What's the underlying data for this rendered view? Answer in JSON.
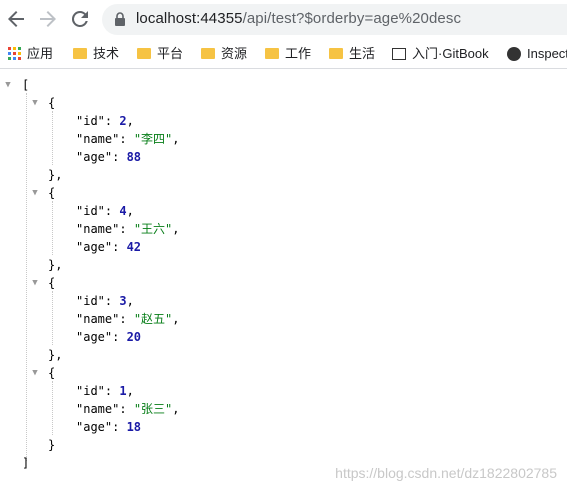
{
  "browser": {
    "url_host": "localhost:44355",
    "url_path": "/api/test?$orderby=age%20desc"
  },
  "bookmarks": [
    {
      "label": "应用",
      "icon": "apps-grid-icon"
    },
    {
      "label": "技术",
      "icon": "folder-icon"
    },
    {
      "label": "平台",
      "icon": "folder-icon"
    },
    {
      "label": "资源",
      "icon": "folder-icon"
    },
    {
      "label": "工作",
      "icon": "folder-icon"
    },
    {
      "label": "生活",
      "icon": "folder-icon"
    },
    {
      "label": "入门·GitBook",
      "icon": "book-icon"
    },
    {
      "label": "Inspect",
      "icon": "globe-icon"
    }
  ],
  "json": {
    "open_bracket": "[",
    "close_bracket": "]",
    "items": [
      {
        "id": "2",
        "name": "\"李四\"",
        "age": "88"
      },
      {
        "id": "4",
        "name": "\"王六\"",
        "age": "42"
      },
      {
        "id": "3",
        "name": "\"赵五\"",
        "age": "20"
      },
      {
        "id": "1",
        "name": "\"张三\"",
        "age": "18"
      }
    ],
    "key_id": "\"id\"",
    "key_name": "\"name\"",
    "key_age": "\"age\""
  },
  "watermark": "https://blog.csdn.net/dz1822802785",
  "colors": {
    "number": "#1a1aa6",
    "string": "#067d17",
    "folder": "#f6c343"
  }
}
